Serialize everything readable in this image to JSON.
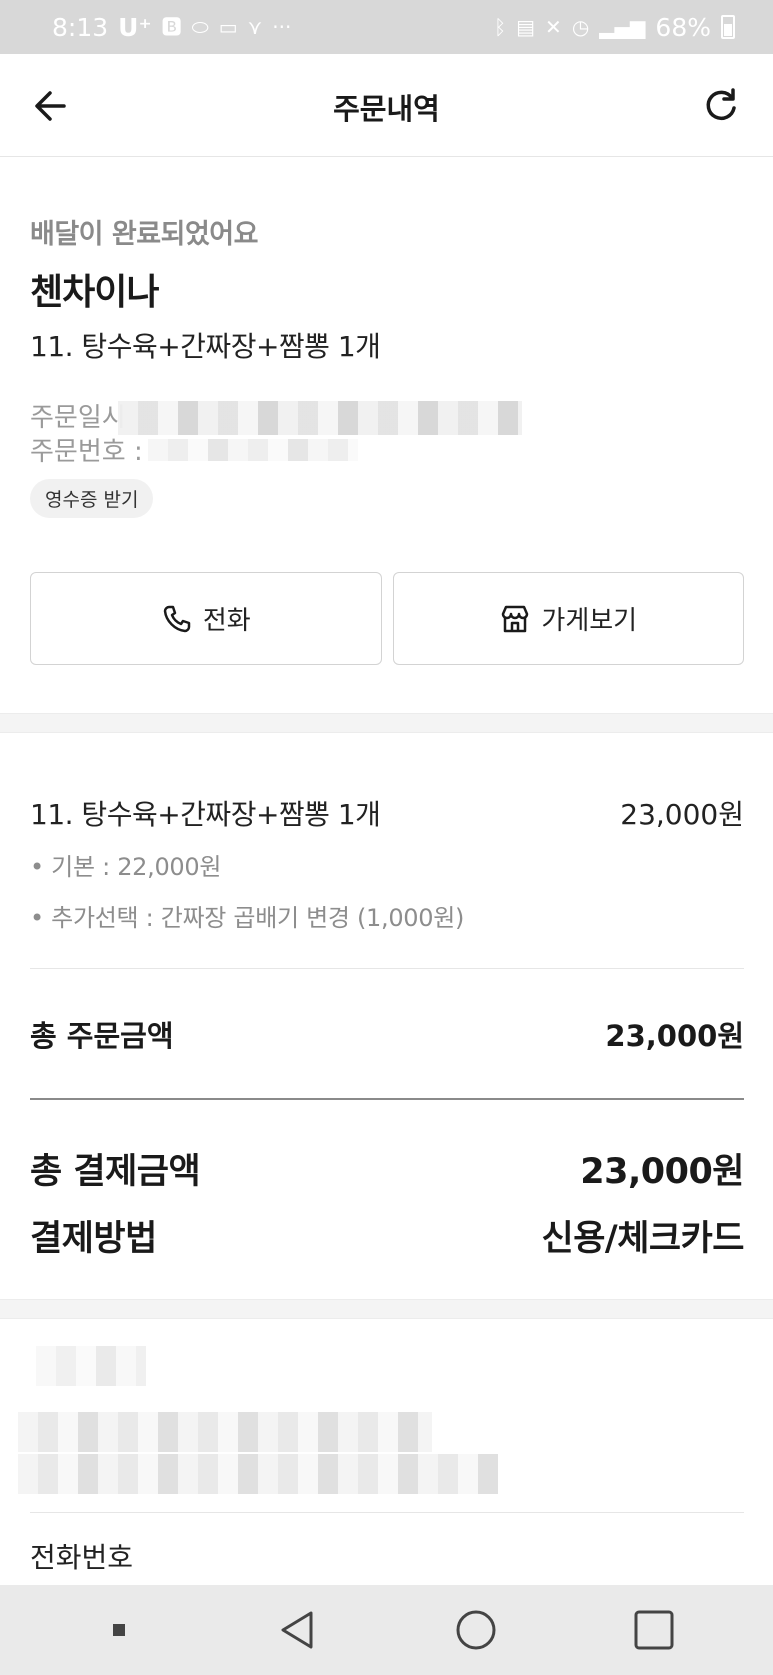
{
  "status_bar": {
    "time": "8:13",
    "carrier": "U⁺",
    "battery": "68%"
  },
  "header": {
    "title": "주문내역"
  },
  "summary": {
    "status": "배달이 완료되었어요",
    "store_name": "첸차이나",
    "menu": "11. 탕수육+간짜장+짬뽕 1개",
    "order_date_label": "주문일시",
    "order_number_label": "주문번호 :",
    "receipt_button": "영수증 받기"
  },
  "actions": {
    "call_label": "전화",
    "store_label": "가게보기"
  },
  "order": {
    "item_name": "11. 탕수육+간짜장+짬뽕 1개",
    "item_price": "23,000원",
    "options": [
      "• 기본 : 22,000원",
      "• 추가선택 : 간짜장 곱배기 변경 (1,000원)"
    ],
    "total_order_label": "총 주문금액",
    "total_order_value": "23,000원",
    "total_payment_label": "총 결제금액",
    "total_payment_value": "23,000원",
    "payment_method_label": "결제방법",
    "payment_method_value": "신용/체크카드"
  },
  "store_info": {
    "phone_label": "전화번호"
  },
  "icons": {
    "back": "arrow-left-icon",
    "refresh": "refresh-icon",
    "phone": "phone-icon",
    "store": "store-icon"
  }
}
